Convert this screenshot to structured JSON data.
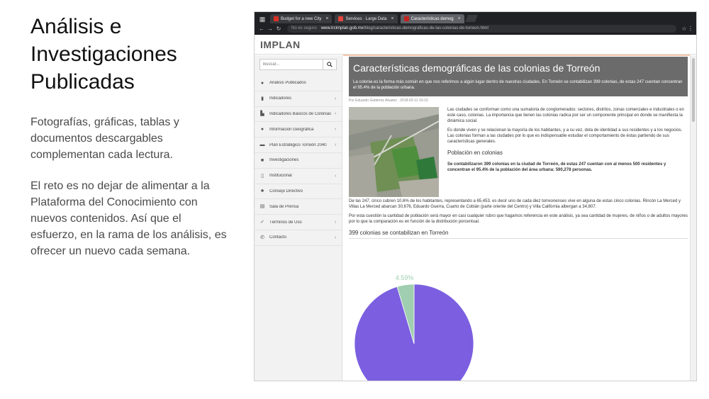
{
  "slide": {
    "title_lines": [
      "Análisis e",
      "Investigaciones",
      "Publicadas"
    ],
    "para1_lines": [
      "Fotografías, gráficas, tablas y",
      "documentos descargables",
      "complementan cada lectura."
    ],
    "para2_lines": [
      "El reto es no dejar de alimentar a la",
      "Plataforma del Conocimiento con",
      "nuevos contenidos. Así que el",
      "esfuerzo, en la rama de los análisis, es",
      "ofrecer un nuevo cada semana."
    ]
  },
  "browser": {
    "tabs": [
      {
        "label": "Budget for a new City",
        "favicon_color": "#d93025"
      },
      {
        "label": "Services · Large Data",
        "favicon_color": "#e8453c"
      },
      {
        "label": "Características demog",
        "favicon_color": "#c5221f"
      }
    ],
    "address": {
      "security": "No es seguro",
      "host": "www.trcimplan.gob.mx",
      "path": "/blog/caracteristicas-demograficas-de-las-colonias-de-torreon.html"
    }
  },
  "site": {
    "logo": "IMPLAN",
    "search_placeholder": "Buscar...",
    "menu": [
      {
        "label": "Análisis Publicados",
        "icon": "pin-icon",
        "glyph": "●",
        "arrow": ""
      },
      {
        "label": "Indicadores",
        "icon": "chart-icon",
        "glyph": "▮",
        "arrow": "‹"
      },
      {
        "label": "Indicadores Básicos de Colonias",
        "icon": "building-icon",
        "glyph": "▙",
        "arrow": "‹"
      },
      {
        "label": "Información Geográfica",
        "icon": "pin-icon",
        "glyph": "●",
        "arrow": "‹"
      },
      {
        "label": "Plan Estratégico Torreón 2040",
        "icon": "car-icon",
        "glyph": "▬",
        "arrow": "‹"
      },
      {
        "label": "Investigaciones",
        "icon": "folder-icon",
        "glyph": "■",
        "arrow": ""
      },
      {
        "label": "Institucional",
        "icon": "document-icon",
        "glyph": "▯",
        "arrow": "‹"
      },
      {
        "label": "Consejo Directivo",
        "icon": "users-icon",
        "glyph": "♣",
        "arrow": ""
      },
      {
        "label": "Sala de Prensa",
        "icon": "newspaper-icon",
        "glyph": "▤",
        "arrow": ""
      },
      {
        "label": "Términos de Uso",
        "icon": "check-icon",
        "glyph": "✓",
        "arrow": "‹"
      },
      {
        "label": "Contacto",
        "icon": "phone-icon",
        "glyph": "✆",
        "arrow": "‹"
      }
    ],
    "article": {
      "title": "Características demográficas de las colonias de Torreón",
      "summary": "La colonia es la forma más común en que nos referimos a algún lugar dentro de nuestras ciudades. En Torreón se contabilizan 399 colonias, de estas 247 cuentan concentran el 95.4% de la población urbana.",
      "byline": "Por Eduardo Gutiérrez Alvarez · 2018-02-12 16:15",
      "p1": "Las ciudades se conforman como una sumatoria de conglomerados: sectores, distritos, zonas comerciales e industriales o en este caso, colonias. La importancia que tienen las colonias radica por ser un componente principal en donde se manifiesta la dinámica social.",
      "p2": "Es donde viven y se relacionan la mayoría de los habitantes, y a su vez, dota de identidad a sus residentes y a los negocios. Las colonias forman a las ciudades por lo que es indispensable estudiar el comportamiento de éstas partiendo de sus características generales.",
      "subhead": "Población en colonias",
      "p3": "Se contabilizaron 399 colonias en la ciudad de Torreón, de estas 247 cuentan con al menos 500 residentes y concentran el 95.4% de la población del área urbana: 590,278 personas.",
      "p4": "De las 247, cinco cubren 10.6% de los habitantes, representando a 65,453. es decir uno de cada diez torreonenses vive en alguna de estas cinco colonias. Rincón La Merced y Villas La Merced abarcan 30,676, Eduardo Guerra, Cuarto de Cobián (parte oriente del Centro) y Villa California albergan a 34,807.",
      "p5": "Por esta cuestión la cantidad de población será mayor en casi cualquier rubro que hagamos referencia en este análisis, ya sea cantidad de mujeres, de niños o de adultos mayores por lo que la comparación es en función de la distribución porcentual.",
      "chart_heading": "399 colonias se contabilizan en Torreón"
    }
  },
  "chart_data": {
    "type": "pie",
    "values": [
      95.41,
      4.59
    ],
    "labels": [
      "95.41%",
      "4.59%"
    ],
    "colors": [
      "#7b5fe0",
      "#9fcfb0"
    ]
  }
}
